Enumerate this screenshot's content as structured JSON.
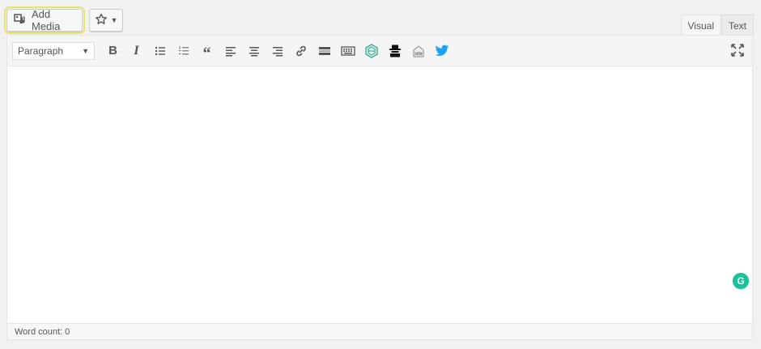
{
  "media_bar": {
    "add_media_label": "Add Media",
    "add_media_icon": "media-icon",
    "favorite_icon": "star-icon"
  },
  "tabs": [
    {
      "label": "Visual",
      "active": true
    },
    {
      "label": "Text",
      "active": false
    }
  ],
  "toolbar": {
    "format_select_value": "Paragraph",
    "buttons": [
      {
        "name": "bold-button",
        "icon": "bold-icon"
      },
      {
        "name": "italic-button",
        "icon": "italic-icon"
      },
      {
        "name": "bulleted-list-button",
        "icon": "bulleted-list-icon"
      },
      {
        "name": "numbered-list-button",
        "icon": "numbered-list-icon"
      },
      {
        "name": "blockquote-button",
        "icon": "blockquote-icon"
      },
      {
        "name": "align-left-button",
        "icon": "align-left-icon"
      },
      {
        "name": "align-center-button",
        "icon": "align-center-icon"
      },
      {
        "name": "align-right-button",
        "icon": "align-right-icon"
      },
      {
        "name": "insert-link-button",
        "icon": "link-icon"
      },
      {
        "name": "read-more-button",
        "icon": "read-more-icon"
      },
      {
        "name": "toolbar-toggle-button",
        "icon": "keyboard-icon"
      },
      {
        "name": "plugin-hex-button",
        "icon": "hexagon-icon"
      },
      {
        "name": "plugin-spy-button",
        "icon": "spy-icon"
      },
      {
        "name": "plugin-gtm-button",
        "icon": "gtm-icon"
      },
      {
        "name": "twitter-button",
        "icon": "twitter-icon"
      }
    ],
    "fullscreen_icon": "fullscreen-icon"
  },
  "editor": {
    "content": ""
  },
  "grammarly": {
    "glyph": "G"
  },
  "status_bar": {
    "word_count": "Word count: 0"
  },
  "colors": {
    "background": "#f1f1f1",
    "toolbar": "#f5f5f5",
    "highlight_outline": "#e7e46b",
    "grammarly": "#15c39a",
    "twitter": "#1da1f2"
  }
}
